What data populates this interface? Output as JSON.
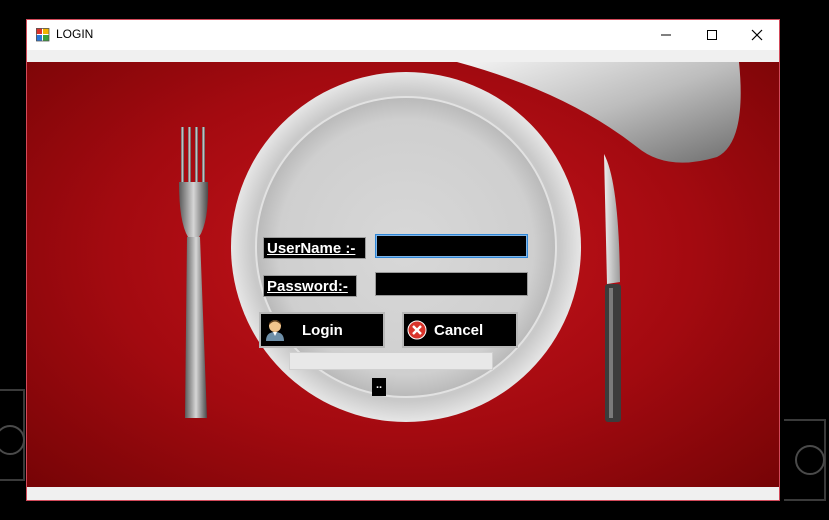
{
  "window": {
    "title": "LOGIN",
    "minimize_icon": "minimize-icon",
    "maximize_icon": "maximize-icon",
    "close_icon": "close-icon"
  },
  "form": {
    "username_label": "UserName :-",
    "password_label": "Password:-",
    "username_value": "",
    "password_value": "",
    "login_label": "Login",
    "cancel_label": "Cancel",
    "status_label": "..",
    "login_icon": "user-avatar-icon",
    "cancel_icon": "red-x-circle-icon"
  },
  "colors": {
    "background_red": "#a30a10",
    "window_border": "#d24a5a",
    "input_focus": "#2f86d6"
  }
}
